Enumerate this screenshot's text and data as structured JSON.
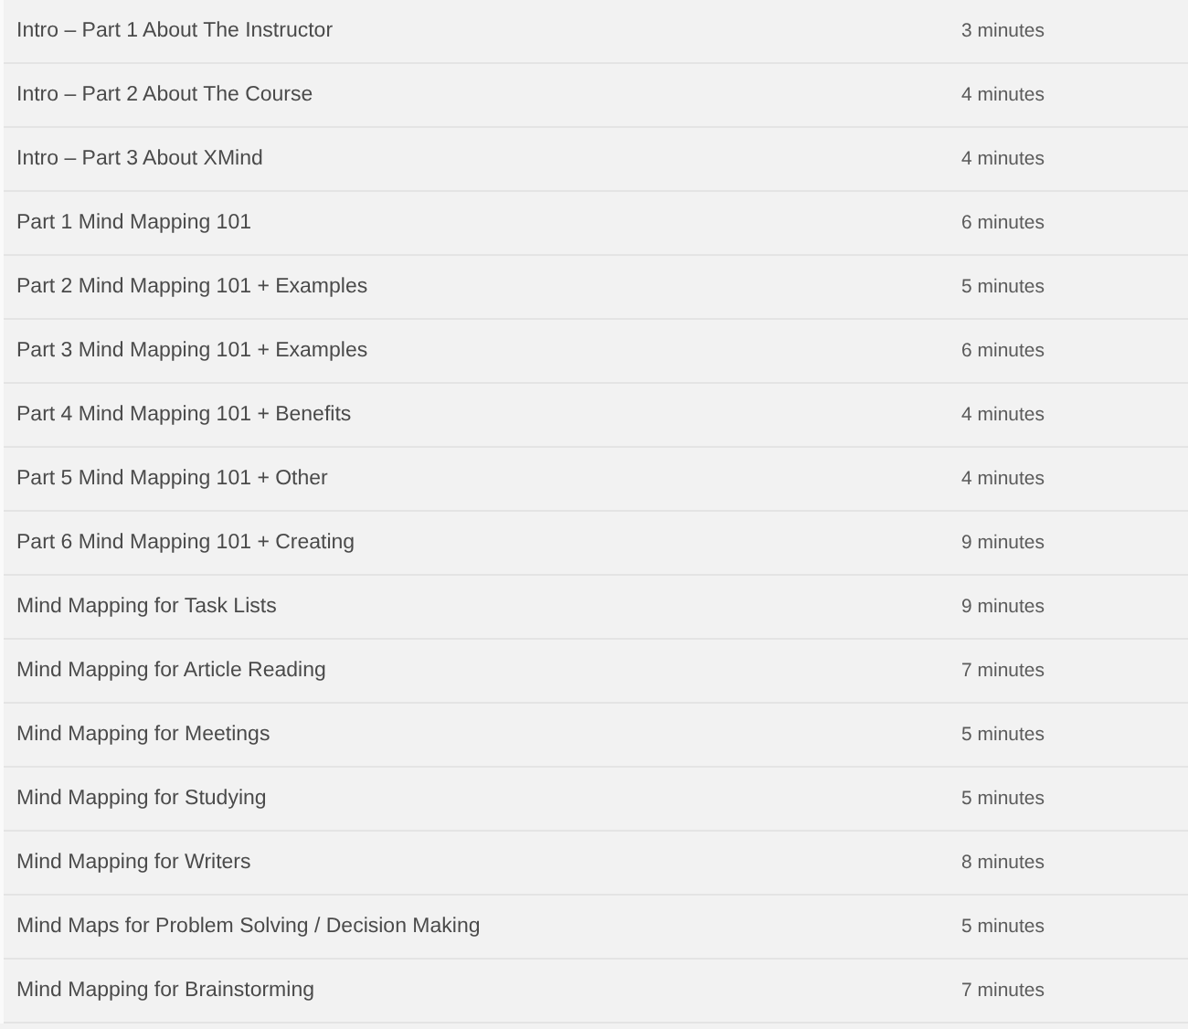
{
  "lessons": [
    {
      "title": "Intro – Part 1 About The Instructor",
      "duration": "3 minutes"
    },
    {
      "title": "Intro – Part 2 About The Course",
      "duration": "4 minutes"
    },
    {
      "title": "Intro – Part 3 About XMind",
      "duration": "4 minutes"
    },
    {
      "title": "Part 1 Mind Mapping 101",
      "duration": "6 minutes"
    },
    {
      "title": "Part 2 Mind Mapping 101 + Examples",
      "duration": "5 minutes"
    },
    {
      "title": "Part 3 Mind Mapping 101 + Examples",
      "duration": "6 minutes"
    },
    {
      "title": "Part 4 Mind Mapping 101 + Benefits",
      "duration": "4 minutes"
    },
    {
      "title": "Part 5 Mind Mapping 101 + Other",
      "duration": "4 minutes"
    },
    {
      "title": "Part 6 Mind Mapping 101 + Creating",
      "duration": "9 minutes"
    },
    {
      "title": "Mind Mapping for Task Lists",
      "duration": "9 minutes"
    },
    {
      "title": "Mind Mapping for Article Reading",
      "duration": "7 minutes"
    },
    {
      "title": "Mind Mapping for Meetings",
      "duration": "5 minutes"
    },
    {
      "title": "Mind Mapping for Studying",
      "duration": "5 minutes"
    },
    {
      "title": "Mind Mapping for Writers",
      "duration": "8 minutes"
    },
    {
      "title": "Mind Maps for Problem Solving / Decision Making",
      "duration": "5 minutes"
    },
    {
      "title": "Mind Mapping for Brainstorming",
      "duration": "7 minutes"
    }
  ]
}
